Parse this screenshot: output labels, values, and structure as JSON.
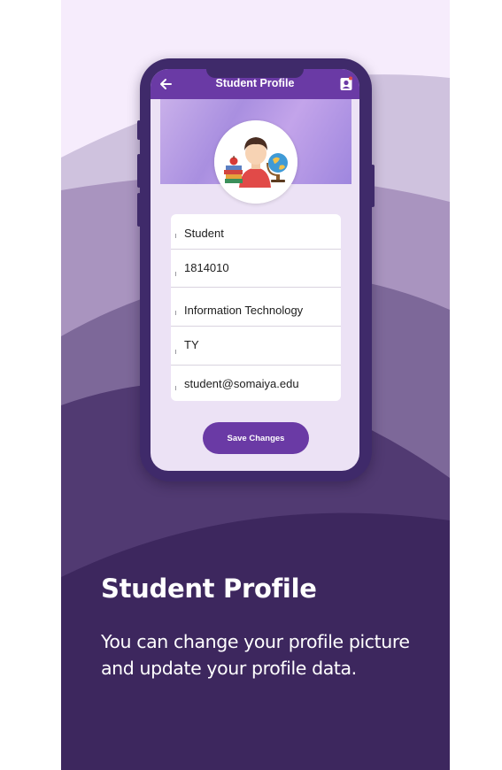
{
  "app_bar": {
    "title": "Student Profile",
    "back_icon": "arrow-left-icon",
    "profile_icon": "user-badge-icon"
  },
  "profile": {
    "avatar_icon": "student-avatar-illustration",
    "fields": [
      {
        "name": "name",
        "value": "Student"
      },
      {
        "name": "roll-number",
        "value": "1814010"
      },
      {
        "name": "department",
        "value": "Information Technology"
      },
      {
        "name": "year",
        "value": "TY"
      },
      {
        "name": "email",
        "value": "student@somaiya.edu"
      }
    ],
    "save_label": "Save Changes"
  },
  "slide": {
    "heading": "Student Profile",
    "description": "You can change your profile picture and update your profile data."
  },
  "colors": {
    "primary": "#6a3aa5",
    "phone_frame": "#3f2a6a",
    "background_dark": "#3d275e",
    "background_light": "#f6ecfc"
  }
}
